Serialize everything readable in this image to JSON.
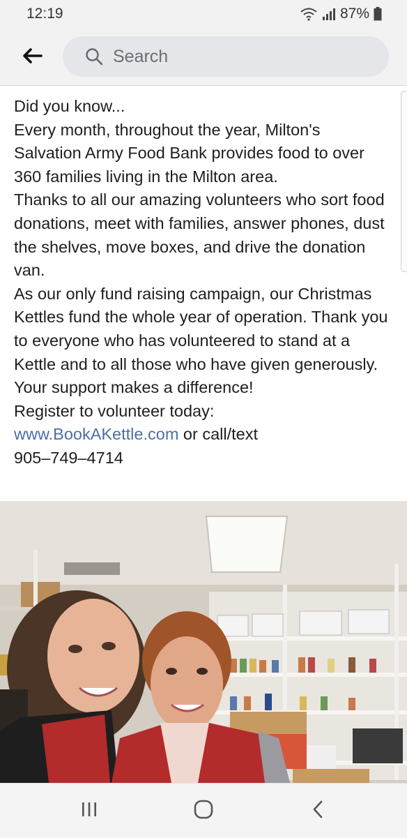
{
  "status_bar": {
    "time": "12:19",
    "battery": "87%",
    "icons": [
      "wifi-icon",
      "signal-icon",
      "battery-icon"
    ]
  },
  "header": {
    "back_icon": "back-arrow-icon",
    "search_placeholder": "Search",
    "search_value": ""
  },
  "post": {
    "paragraphs": [
      "Did you know...",
      "Every month, throughout the year, Milton's Salvation Army Food Bank provides food to over 360 families living in the Milton area.",
      "Thanks to all our amazing volunteers who sort food donations, meet with families, answer phones, dust the shelves, move boxes, and drive the donation van.",
      "As our only fund raising campaign, our Christmas Kettles fund the whole year of operation. Thank you to everyone who has volunteered to stand at a Kettle and to all those who have given generously. Your support makes a difference!",
      "Register to volunteer today:"
    ],
    "link_text": "www.BookAKettle.com",
    "after_link": " or call/text",
    "phone": "905–749–4714"
  },
  "nav_bar": {
    "icons": [
      "recent-apps-icon",
      "home-icon",
      "back-icon"
    ]
  },
  "colors": {
    "link": "#4b6fa5",
    "background": "#ffffff",
    "chrome": "#f2f2f2",
    "search_box": "#e4e6e9"
  }
}
